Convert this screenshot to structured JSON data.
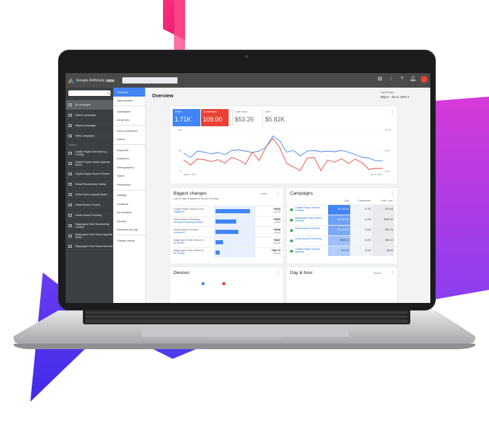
{
  "colors": {
    "accent": "#4285f4",
    "conversions": "#ea4335",
    "sidebar": "#3c4043",
    "topbar": "#4a4a4a",
    "green": "#34a853"
  },
  "topbar": {
    "product": "Google AdWords",
    "badge": "BETA",
    "icons": [
      "reports-icon",
      "more-icon",
      "help-icon",
      "notifications-icon",
      "account-avatar"
    ]
  },
  "sidebar": {
    "search_icon": "chevron-down-icon",
    "items": [
      {
        "label": "All campaigns",
        "icon": "grid-icon",
        "selected": true
      },
      {
        "label": "Search campaigns",
        "icon": "search-campaign-icon"
      },
      {
        "label": "Display campaigns",
        "icon": "display-campaign-icon"
      },
      {
        "label": "Video campaigns",
        "icon": "video-campaign-icon"
      }
    ],
    "section_label": "Content",
    "campaigns": [
      "Capital Region Generators g Cooling",
      "Capital Region Search Appeals Brand",
      "Capital Region Search General",
      "Vestal Remarketing Cooling",
      "Vestal Search Appeals Brand",
      "Vestal Search General",
      "Vestal Search Plumbing",
      "Wappingers Falls Remarketing Cooling",
      "Wappingers Falls Search Appeals Brand",
      "Wappingers Falls Search General"
    ]
  },
  "nav": {
    "groups": [
      [
        "Overview",
        "Opportunities"
      ],
      [
        "Campaigns",
        "Ad groups"
      ],
      [
        "Ads & extensions",
        "Videos"
      ],
      [
        "Keywords",
        "Audiences",
        "Demographics",
        "Topics",
        "Placements"
      ],
      [
        "Settings",
        "Locations",
        "Ad schedule",
        "Devices",
        "Advanced bid adj."
      ],
      [
        "Change history"
      ]
    ],
    "active": "Overview"
  },
  "overview": {
    "title": "Overview",
    "date_label": "Last 30 days",
    "date_range": "May 6 – Jun 4, 2017",
    "metrics": [
      {
        "label": "Clicks",
        "value": "1.71K",
        "color": "#4285f4",
        "selected": true
      },
      {
        "label": "Conversions",
        "value": "109.00",
        "color": "#ea4335",
        "selected": true
      },
      {
        "label": "Cost / conv.",
        "value": "$53.26",
        "color": "#ffffff",
        "selected": false
      },
      {
        "label": "Cost",
        "value": "$5.82K",
        "color": "#ffffff",
        "selected": false
      }
    ]
  },
  "chart_data": {
    "type": "line",
    "x_start_label": "May 6, 2017",
    "x_end_label": "Jun 4, 2017",
    "y_left_ticks": [
      "120",
      "60",
      "0"
    ],
    "y_right_ticks": [
      "12.00",
      "6.00",
      "0.00"
    ],
    "series": [
      {
        "name": "Clicks",
        "color": "#4285f4",
        "values": [
          52,
          40,
          58,
          55,
          50,
          54,
          48,
          60,
          62,
          58,
          54,
          58,
          70,
          102,
          88,
          55,
          60,
          44,
          58,
          60,
          56,
          58,
          56,
          60,
          55,
          48,
          40,
          38,
          30,
          30
        ]
      },
      {
        "name": "Conversions",
        "color": "#ea4335",
        "values": [
          3.2,
          1.8,
          3.5,
          3.3,
          2.8,
          3.3,
          2.3,
          4.0,
          3.3,
          2.0,
          5.5,
          3.1,
          7.0,
          9.5,
          6.8,
          2.3,
          1.2,
          0.2,
          3.8,
          4.0,
          0.2,
          3.2,
          2.6,
          3.6,
          2.2,
          3.5,
          2.4,
          0.5,
          0.8,
          0.8
        ]
      }
    ]
  },
  "biggest_changes": {
    "title": "Biggest changes",
    "subtitle": "Last 30 days compared to the prior 30 days",
    "dropdown": "Cost",
    "rows": [
      {
        "l1": "Capital Region Search Gen...",
        "l2": "Capital AC",
        "bar": 0.92,
        "c1": "+$415",
        "c2": "+44.2%"
      },
      {
        "l1": "Vestal Search Plumbing -",
        "l2": "General Plumbing services",
        "bar": 0.55,
        "c1": "+$329",
        "c2": "+135%"
      },
      {
        "l1": "Vestal Search General -",
        "l2": "Central AC",
        "bar": 0.62,
        "c1": "+$298",
        "c2": "+511%"
      },
      {
        "l1": "Wappingers Falls Search G...",
        "l2": "AC Brand",
        "bar": 0.2,
        "c1": "+$187",
        "c2": "+64.3%"
      },
      {
        "l1": "Wappingers Falls Search G...",
        "l2": "AC Repair",
        "bar": 0.12,
        "c1": "+$54.73",
        "c2": "+66.2%"
      }
    ]
  },
  "campaigns": {
    "title": "Campaigns",
    "headers": [
      "Cost",
      "Conversions",
      "Cost / conv."
    ],
    "rows": [
      {
        "name": "Capital Region Search General",
        "cost": "$1,751.66",
        "conv": "37.00",
        "cpc": "$73.54",
        "shade": 1.0
      },
      {
        "name": "Wappingers Falls Search General",
        "cost": "$1,321.96",
        "conv": "11.00",
        "cpc": "$181.44",
        "shade": 0.7
      },
      {
        "name": "Vestal Search General",
        "cost": "$1,211.34",
        "conv": "19.00",
        "cpc": "$63.75",
        "shade": 0.6
      },
      {
        "name": "Vestal Search Plumbing",
        "cost": "$385.41",
        "conv": "13.00",
        "cpc": "$62.45",
        "shade": 0.35
      },
      {
        "name": "Capital Region Search Appeals",
        "cost": "$73.85",
        "conv": "20.00",
        "cpc": "$8.69",
        "shade": 0.2
      }
    ]
  },
  "devices": {
    "title": "Devices"
  },
  "dayhour": {
    "title": "Day & hour",
    "dropdown": "Hour"
  }
}
